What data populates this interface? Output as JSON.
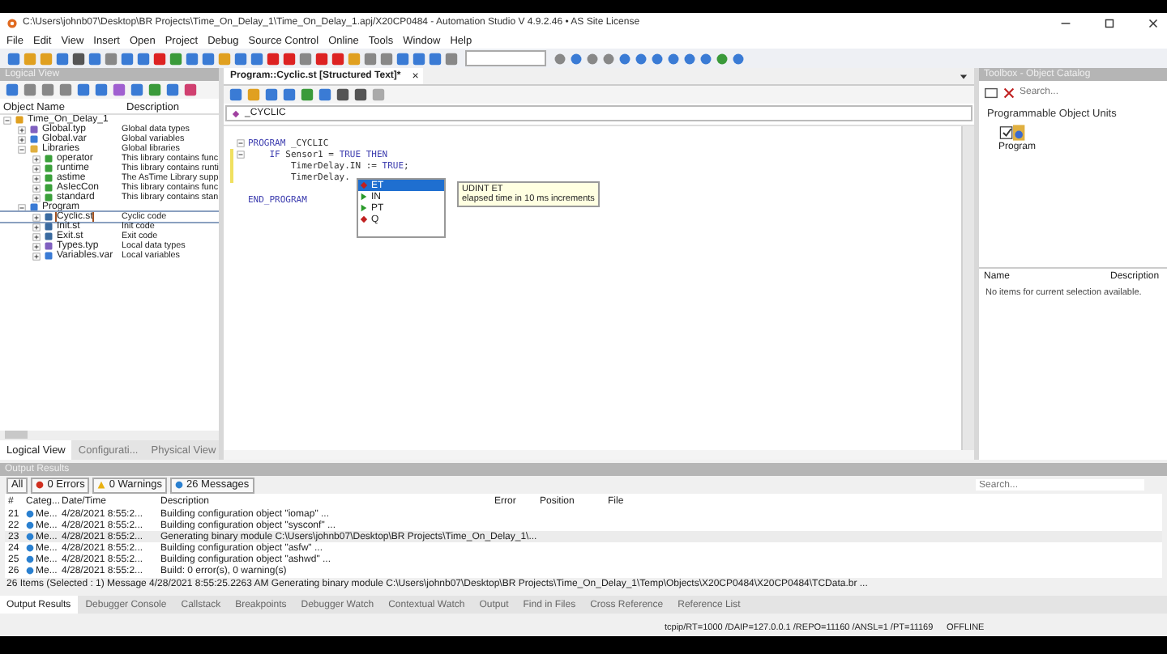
{
  "window": {
    "title": "C:\\Users\\johnb07\\Desktop\\BR Projects\\Time_On_Delay_1\\Time_On_Delay_1.apj/X20CP0484 - Automation Studio V 4.9.2.46 • AS Site License"
  },
  "menu": [
    "File",
    "Edit",
    "View",
    "Insert",
    "Open",
    "Project",
    "Debug",
    "Source Control",
    "Online",
    "Tools",
    "Window",
    "Help"
  ],
  "logical_view": {
    "title": "Logical View",
    "columns": [
      "Object Name",
      "Description"
    ],
    "tree": [
      {
        "name": "Time_On_Delay_1",
        "kind": "project",
        "selected": false,
        "expanded": true,
        "children": [
          {
            "name": "Global.typ",
            "description": "Global data types",
            "kind": "typ",
            "selected": false
          },
          {
            "name": "Global.var",
            "description": "Global variables",
            "kind": "var",
            "selected": false
          },
          {
            "name": "Libraries",
            "description": "Global libraries",
            "kind": "folder",
            "selected": false,
            "expanded": true,
            "children": [
              {
                "name": "operator",
                "description": "This library contains func",
                "kind": "lib",
                "selected": false
              },
              {
                "name": "runtime",
                "description": "This library contains runti",
                "kind": "lib",
                "selected": false
              },
              {
                "name": "astime",
                "description": "The AsTime Library supp",
                "kind": "lib",
                "selected": false
              },
              {
                "name": "AsIecCon",
                "description": "This library contains func",
                "kind": "lib",
                "selected": false
              },
              {
                "name": "standard",
                "description": "This library contains stan",
                "kind": "lib",
                "selected": false
              }
            ]
          },
          {
            "name": "Program",
            "kind": "program",
            "selected": false,
            "expanded": true,
            "children": [
              {
                "name": "Cyclic.st",
                "description": "Cyclic code",
                "kind": "st",
                "selected": true
              },
              {
                "name": "Init.st",
                "description": "Init code",
                "kind": "st",
                "selected": false
              },
              {
                "name": "Exit.st",
                "description": "Exit code",
                "kind": "st",
                "selected": false
              },
              {
                "name": "Types.typ",
                "description": "Local data types",
                "kind": "typ",
                "selected": false
              },
              {
                "name": "Variables.var",
                "description": "Local variables",
                "kind": "var",
                "selected": false
              }
            ]
          }
        ]
      }
    ],
    "tabs": [
      {
        "label": "Logical View",
        "selected": true
      },
      {
        "label": "Configurati...",
        "selected": false
      },
      {
        "label": "Physical View",
        "selected": false
      }
    ]
  },
  "editor": {
    "tab": "Program::Cyclic.st [Structured Text]*",
    "close": "×",
    "section": "_CYCLIC",
    "lines": [
      {
        "kind": "code",
        "fold": true,
        "changed": false,
        "tokens": [
          {
            "text": "PROGRAM",
            "kind": "keyword"
          },
          {
            "text": " _CYCLIC",
            "kind": "plain"
          }
        ]
      },
      {
        "kind": "code",
        "fold": true,
        "changed": true,
        "tokens": [
          {
            "text": "    IF",
            "kind": "keyword"
          },
          {
            "text": " Sensor1 = ",
            "kind": "plain"
          },
          {
            "text": "TRUE THEN",
            "kind": "keyword"
          }
        ]
      },
      {
        "kind": "code",
        "fold": false,
        "changed": true,
        "tokens": [
          {
            "text": "        TimerDelay.IN := ",
            "kind": "plain"
          },
          {
            "text": "TRUE",
            "kind": "keyword"
          },
          {
            "text": ";",
            "kind": "plain"
          }
        ]
      },
      {
        "kind": "code",
        "fold": false,
        "changed": true,
        "tokens": [
          {
            "text": "        TimerDelay.",
            "kind": "plain"
          }
        ]
      },
      {
        "kind": "blank",
        "fold": false,
        "changed": false
      },
      {
        "kind": "code",
        "fold": false,
        "changed": false,
        "tokens": [
          {
            "text": "END_PROGRAM",
            "kind": "keyword"
          }
        ]
      }
    ],
    "completion": [
      {
        "label": "ET",
        "kind": "output",
        "selected": true
      },
      {
        "label": "IN",
        "kind": "input",
        "selected": false
      },
      {
        "label": "PT",
        "kind": "input",
        "selected": false
      },
      {
        "label": "Q",
        "kind": "output",
        "selected": false
      }
    ],
    "tooltip": {
      "type": "UDINT ET",
      "text": "elapsed time in 10 ms increments"
    }
  },
  "toolbox": {
    "title": "Toolbox - Object Catalog",
    "search": {
      "placeholder": "Search..."
    },
    "group": "Programmable Object Units",
    "items": [
      "Program"
    ],
    "columns": [
      "Name",
      "Description"
    ],
    "empty": "No items for current selection available."
  },
  "output": {
    "title": "Output Results",
    "filters": [
      {
        "label": "All",
        "kind": "all"
      },
      {
        "label": "0 Errors",
        "kind": "error"
      },
      {
        "label": "0 Warnings",
        "kind": "warning"
      },
      {
        "label": "26 Messages",
        "kind": "message"
      }
    ],
    "search": {
      "placeholder": "Search..."
    },
    "columns": [
      "#",
      "Categ...",
      "Date/Time",
      "Description",
      "Error",
      "Position",
      "File"
    ],
    "rows": [
      {
        "num": "21",
        "category": "Me...",
        "time": "4/28/2021 8:55:2...",
        "description": "Building configuration object \"iomap\" ...",
        "selected": false
      },
      {
        "num": "22",
        "category": "Me...",
        "time": "4/28/2021 8:55:2...",
        "description": "Building configuration object \"sysconf\" ...",
        "selected": false
      },
      {
        "num": "23",
        "category": "Me...",
        "time": "4/28/2021 8:55:2...",
        "description": "Generating binary module C:\\Users\\johnb07\\Desktop\\BR Projects\\Time_On_Delay_1\\...",
        "selected": true
      },
      {
        "num": "24",
        "category": "Me...",
        "time": "4/28/2021 8:55:2...",
        "description": "Building configuration object \"asfw\" ...",
        "selected": false
      },
      {
        "num": "25",
        "category": "Me...",
        "time": "4/28/2021 8:55:2...",
        "description": "Building configuration object \"ashwd\" ...",
        "selected": false
      },
      {
        "num": "26",
        "category": "Me...",
        "time": "4/28/2021 8:55:2...",
        "description": "Build: 0 error(s), 0 warning(s)",
        "selected": false
      }
    ],
    "summary": "26 Items (Selected : 1)  Message 4/28/2021 8:55:25.2263 AM Generating binary module C:\\Users\\johnb07\\Desktop\\BR Projects\\Time_On_Delay_1\\Temp\\Objects\\X20CP0484\\X20CP0484\\TCData.br ...",
    "tabs": [
      {
        "label": "Output Results",
        "selected": true
      },
      {
        "label": "Debugger Console",
        "selected": false
      },
      {
        "label": "Callstack",
        "selected": false
      },
      {
        "label": "Breakpoints",
        "selected": false
      },
      {
        "label": "Debugger Watch",
        "selected": false
      },
      {
        "label": "Contextual Watch",
        "selected": false
      },
      {
        "label": "Output",
        "selected": false
      },
      {
        "label": "Find in Files",
        "selected": false
      },
      {
        "label": "Cross Reference",
        "selected": false
      },
      {
        "label": "Reference List",
        "selected": false
      }
    ]
  },
  "status_bar": {
    "connection": "tcpip/RT=1000 /DAIP=127.0.0.1 /REPO=11160 /ANSL=1 /PT=11169",
    "state": "OFFLINE"
  }
}
